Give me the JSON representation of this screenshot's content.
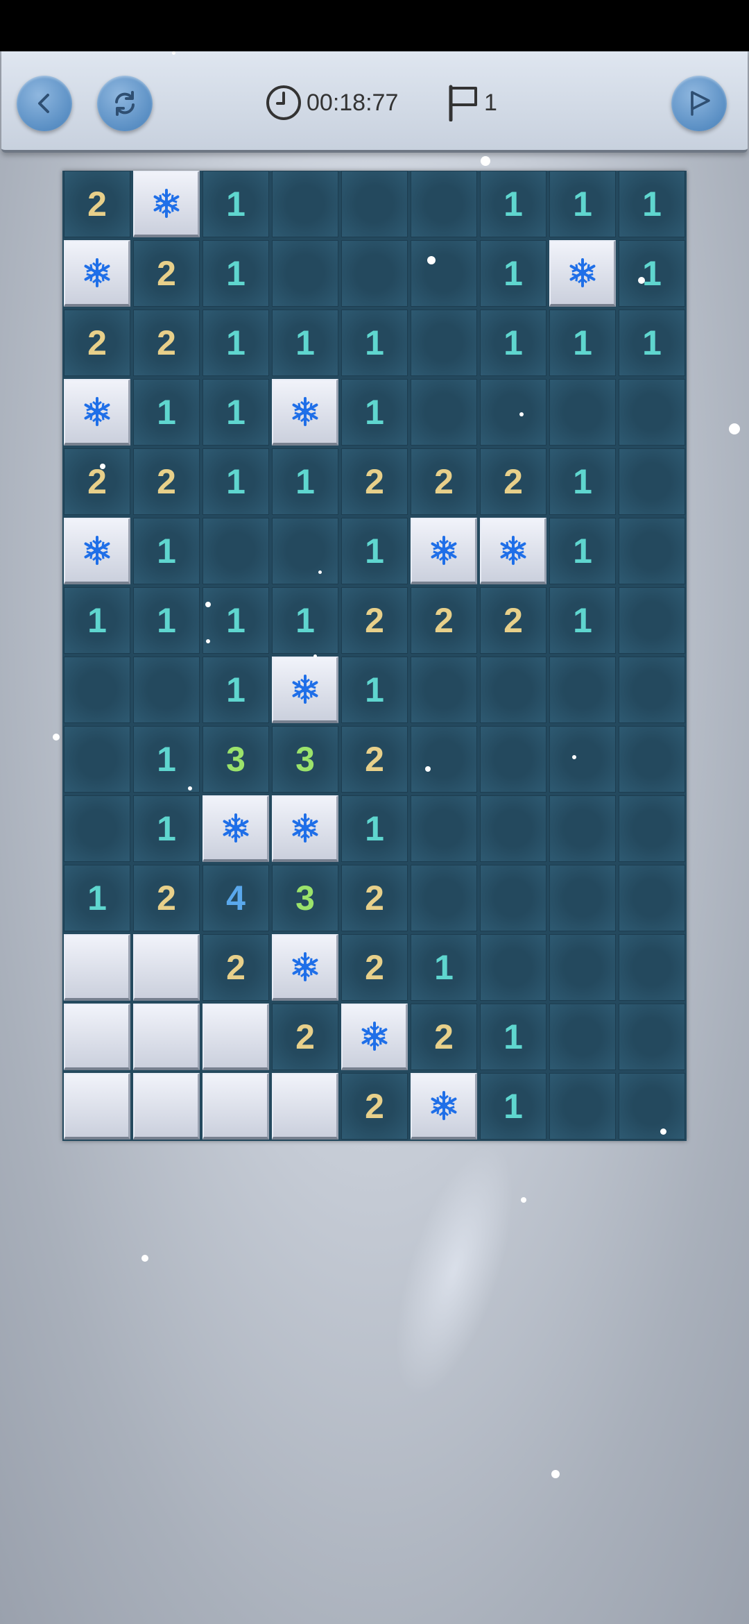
{
  "header": {
    "timer": "00:18:77",
    "flag_count": "1",
    "icons": {
      "back": "chevron-left-icon",
      "restart": "refresh-icon",
      "clock": "clock-icon",
      "flag": "flag-icon",
      "flag_mode": "flag-mode-icon"
    }
  },
  "board": {
    "rows": 14,
    "cols": 9,
    "legend": "F = flagged (snowflake), C = covered, E = empty opened, digit = adjacent count",
    "cells": [
      [
        "2",
        "F",
        "1",
        "E",
        "E",
        "E",
        "1",
        "1",
        "1"
      ],
      [
        "F",
        "2",
        "1",
        "E",
        "E",
        "E",
        "1",
        "F",
        "1"
      ],
      [
        "2",
        "2",
        "1",
        "1",
        "1",
        "E",
        "1",
        "1",
        "1"
      ],
      [
        "F",
        "1",
        "1",
        "F",
        "1",
        "E",
        "E",
        "E",
        "E"
      ],
      [
        "2",
        "2",
        "1",
        "1",
        "2",
        "2",
        "2",
        "1",
        "E"
      ],
      [
        "F",
        "1",
        "E",
        "E",
        "1",
        "F",
        "F",
        "1",
        "E"
      ],
      [
        "1",
        "1",
        "1",
        "1",
        "2",
        "2",
        "2",
        "1",
        "E"
      ],
      [
        "E",
        "E",
        "1",
        "F",
        "1",
        "E",
        "E",
        "E",
        "E"
      ],
      [
        "E",
        "1",
        "3",
        "3",
        "2",
        "E",
        "E",
        "E",
        "E"
      ],
      [
        "E",
        "1",
        "F",
        "F",
        "1",
        "E",
        "E",
        "E",
        "E"
      ],
      [
        "1",
        "2",
        "4",
        "3",
        "2",
        "E",
        "E",
        "E",
        "E"
      ],
      [
        "C",
        "C",
        "2",
        "F",
        "2",
        "1",
        "E",
        "E",
        "E"
      ],
      [
        "C",
        "C",
        "C",
        "2",
        "F",
        "2",
        "1",
        "E",
        "E"
      ],
      [
        "C",
        "C",
        "C",
        "C",
        "2",
        "F",
        "1",
        "E",
        "E"
      ]
    ]
  },
  "colors": {
    "board_bg": "#24495e",
    "num_1": "#5fd6cf",
    "num_2": "#e8d08a",
    "num_3": "#9be36b",
    "num_4": "#5aa8ec",
    "flake": "#1f6fe8"
  }
}
